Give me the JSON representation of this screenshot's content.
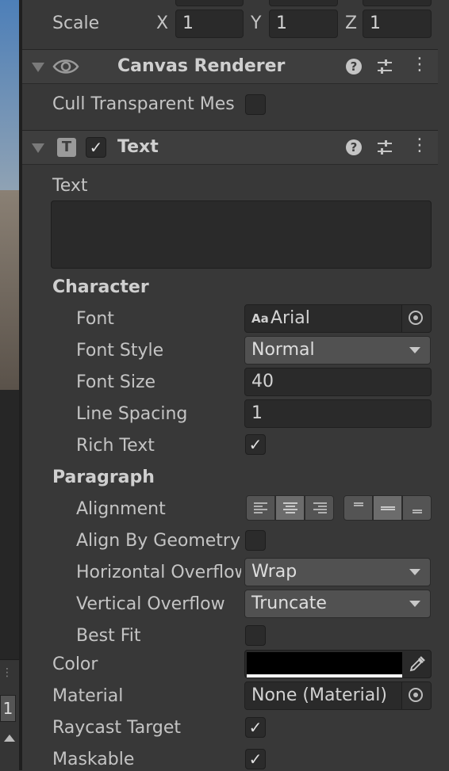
{
  "transform": {
    "scale_label": "Scale",
    "x_label": "X",
    "x_value": "1",
    "y_label": "Y",
    "y_value": "1",
    "z_label": "Z",
    "z_value": "1"
  },
  "canvas_renderer": {
    "title": "Canvas Renderer",
    "cull_label": "Cull Transparent Mes"
  },
  "text_component": {
    "title": "Text",
    "text_label": "Text",
    "text_value": "",
    "character_header": "Character",
    "font_label": "Font",
    "font_value": "Arial",
    "font_prefix": "Aa",
    "font_style_label": "Font Style",
    "font_style_value": "Normal",
    "font_size_label": "Font Size",
    "font_size_value": "40",
    "line_spacing_label": "Line Spacing",
    "line_spacing_value": "1",
    "rich_text_label": "Rich Text",
    "rich_text_checked": true,
    "paragraph_header": "Paragraph",
    "alignment_label": "Alignment",
    "alignment_horizontal_selected": "center",
    "alignment_vertical_selected": "middle",
    "align_geometry_label": "Align By Geometry",
    "align_geometry_checked": false,
    "h_overflow_label": "Horizontal Overflow",
    "h_overflow_value": "Wrap",
    "v_overflow_label": "Vertical Overflow",
    "v_overflow_value": "Truncate",
    "best_fit_label": "Best Fit",
    "best_fit_checked": false,
    "color_label": "Color",
    "color_value": "#000000",
    "material_label": "Material",
    "material_value": "None (Material)",
    "raycast_label": "Raycast Target",
    "raycast_checked": true,
    "maskable_label": "Maskable",
    "maskable_checked": true
  },
  "side_strip": {
    "badge": "1"
  },
  "colors": {
    "panel_bg": "#383838",
    "header_bg": "#3e3e3e",
    "field_bg": "#2a2a2a",
    "dropdown_bg": "#515151"
  }
}
